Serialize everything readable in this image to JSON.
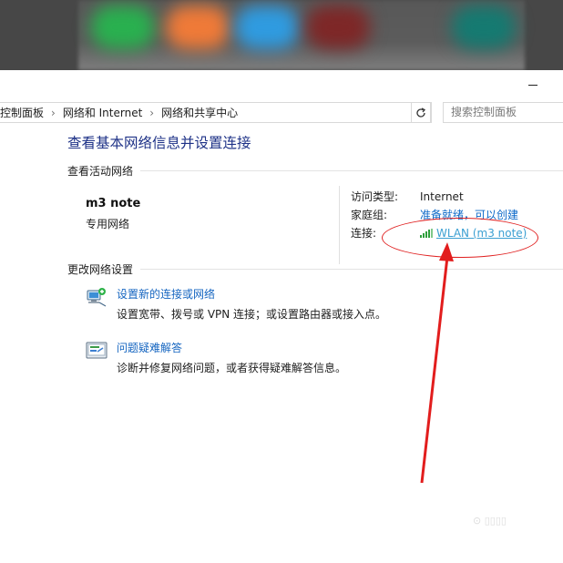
{
  "breadcrumb": {
    "items": [
      "控制面板",
      "网络和 Internet",
      "网络和共享中心"
    ],
    "separator": "›"
  },
  "search": {
    "placeholder": "搜索控制面板"
  },
  "main": {
    "title": "查看基本网络信息并设置连接",
    "active_networks_heading": "查看活动网络",
    "network": {
      "name": "m3 note",
      "type": "专用网络",
      "access_type_label": "访问类型:",
      "access_type_value": "Internet",
      "homegroup_label": "家庭组:",
      "homegroup_value": "准备就绪，可以创建",
      "connection_label": "连接:",
      "connection_value": "WLAN (m3 note)"
    },
    "change_settings_heading": "更改网络设置",
    "tasks": [
      {
        "icon": "network-setup-icon",
        "link": "设置新的连接或网络",
        "description": "设置宽带、拨号或 VPN 连接；或设置路由器或接入点。"
      },
      {
        "icon": "troubleshoot-icon",
        "link": "问题疑难解答",
        "description": "诊断并修复网络问题，或者获得疑难解答信息。"
      }
    ]
  },
  "icons": {
    "dropdown": "chevron-down-icon",
    "refresh": "refresh-icon",
    "minimize": "minimize-icon",
    "signal": "wifi-signal-icon"
  },
  "colors": {
    "link": "#1565c0",
    "title": "#1e3287",
    "annotation": "#e02020"
  }
}
